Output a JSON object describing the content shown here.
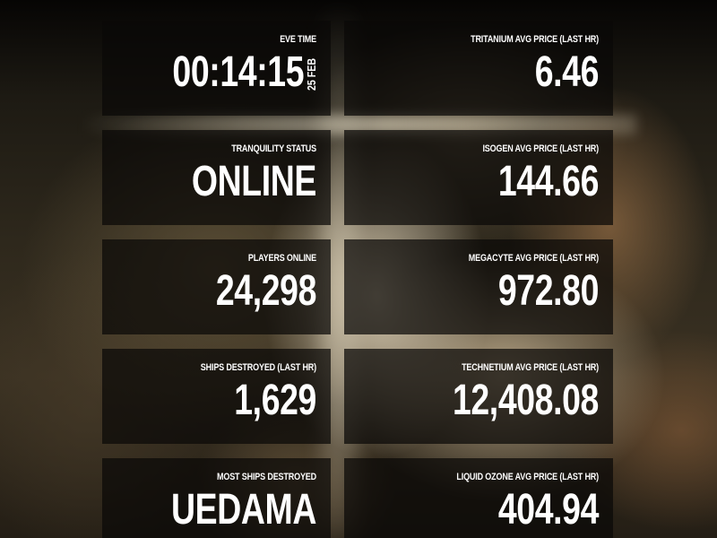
{
  "eve_time": {
    "label": "EVE TIME",
    "time": "00:14:15",
    "date": "25 FEB"
  },
  "tranquility_status": {
    "label": "TRANQUILITY STATUS",
    "value": "ONLINE"
  },
  "players_online": {
    "label": "PLAYERS ONLINE",
    "value": "24,298"
  },
  "ships_destroyed": {
    "label": "SHIPS DESTROYED (LAST HR)",
    "value": "1,629"
  },
  "most_ships_destroyed": {
    "label": "MOST SHIPS DESTROYED",
    "value": "UEDAMA"
  },
  "tritanium": {
    "label": "TRITANIUM AVG PRICE (LAST HR)",
    "value": "6.46"
  },
  "isogen": {
    "label": "ISOGEN AVG PRICE (LAST HR)",
    "value": "144.66"
  },
  "megacyte": {
    "label": "MEGACYTE AVG PRICE (LAST HR)",
    "value": "972.80"
  },
  "technetium": {
    "label": "TECHNETIUM AVG PRICE (LAST HR)",
    "value": "12,408.08"
  },
  "liquid_ozone": {
    "label": "LIQUID OZONE AVG PRICE (LAST HR)",
    "value": "404.94"
  }
}
